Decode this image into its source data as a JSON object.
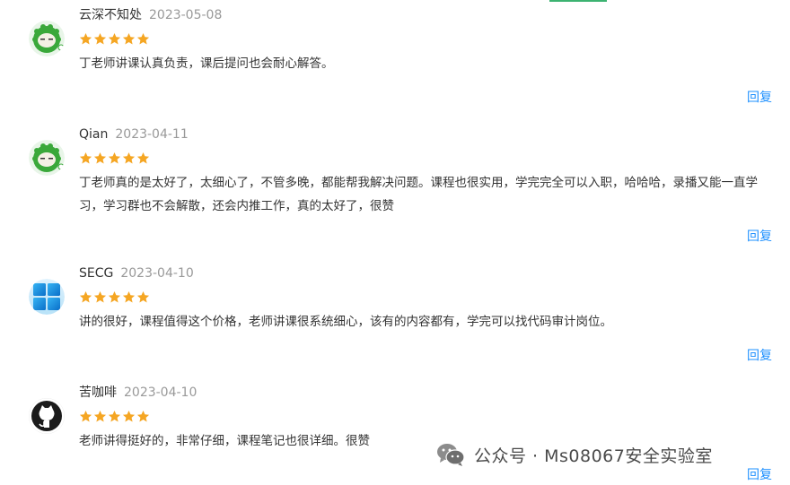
{
  "reviews": [
    {
      "user": "云深不知处",
      "date": "2023-05-08",
      "rating": 5,
      "avatar": "green-cactus-avatar",
      "text": "丁老师讲课认真负责，课后提问也会耐心解答。",
      "reply_label": "回复"
    },
    {
      "user": "Qian",
      "date": "2023-04-11",
      "rating": 5,
      "avatar": "green-cactus-avatar",
      "text": "丁老师真的是太好了，太细心了，不管多晚，都能帮我解决问题。课程也很实用，学完完全可以入职，哈哈哈，录播又能一直学习，学习群也不会解散，还会内推工作，真的太好了，很赞",
      "reply_label": "回复"
    },
    {
      "user": "SECG",
      "date": "2023-04-10",
      "rating": 5,
      "avatar": "windows-logo-avatar",
      "text": "讲的很好，课程值得这个价格，老师讲课很系统细心，该有的内容都有，学完可以找代码审计岗位。",
      "reply_label": "回复"
    },
    {
      "user": "苦咖啡",
      "date": "2023-04-10",
      "rating": 5,
      "avatar": "github-octocat-avatar",
      "text": "老师讲得挺好的，非常仔细，课程笔记也很详细。很赞",
      "reply_label": "回复"
    }
  ],
  "watermark": {
    "text": "公众号 · Ms08067安全实验室",
    "icon": "wechat-logo-icon"
  },
  "colors": {
    "star": "#f5a623",
    "reply_link": "#1e90ff",
    "date": "#999999",
    "accent_strip": "#3cb371"
  }
}
